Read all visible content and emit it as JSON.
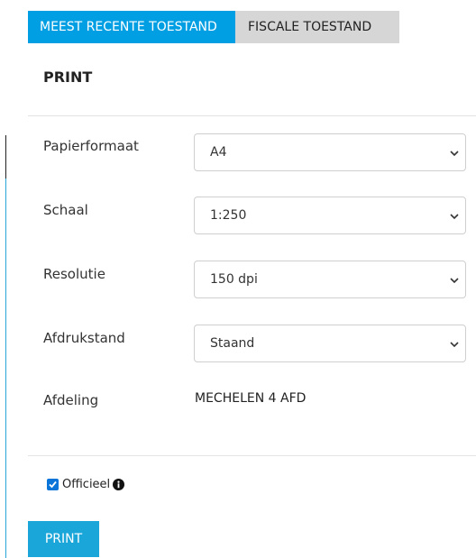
{
  "tabs": [
    {
      "label": "MEEST RECENTE TOESTAND",
      "active": true
    },
    {
      "label": "FISCALE TOESTAND",
      "active": false
    }
  ],
  "section_title": "PRINT",
  "fields": {
    "paper": {
      "label": "Papierformaat",
      "value": "A4"
    },
    "scale": {
      "label": "Schaal",
      "value": "1:250"
    },
    "resolution": {
      "label": "Resolutie",
      "value": "150 dpi"
    },
    "orientation": {
      "label": "Afdrukstand",
      "value": "Staand"
    },
    "division": {
      "label": "Afdeling",
      "value": "MECHELEN 4 AFD"
    }
  },
  "official": {
    "label": "Officieel",
    "checked": true,
    "info_icon": "info-icon"
  },
  "print_button": "PRINT",
  "colors": {
    "accent": "#009fe3",
    "button": "#1aa6d9",
    "checkbox": "#0a74d9",
    "tab_inactive": "#d6d6d6"
  }
}
